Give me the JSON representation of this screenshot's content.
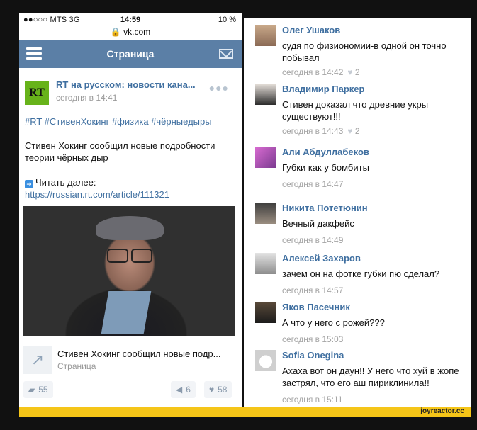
{
  "status_bar": {
    "carrier": "●●○○○ MTS  3G",
    "time": "14:59",
    "battery": "10 %"
  },
  "url": "vk.com",
  "navbar": {
    "title": "Страница"
  },
  "post": {
    "name": "RT на русском: новости кана...",
    "time": "сегодня в 14:41",
    "logo_text": "RT",
    "tags": "#RT #СтивенХокинг #физика #чёрныедыры",
    "text": "Стивен Хокинг сообщил новые подробности теории чёрных дыр",
    "read_more": "Читать далее:",
    "link": "https://russian.rt.com/article/111321",
    "share_title": "Стивен Хокинг сообщил новые подр...",
    "share_sub": "Страница",
    "comments_count": "55",
    "reposts_count": "6",
    "likes_count": "58"
  },
  "comments": [
    {
      "name": "Олег Ушаков",
      "text": "судя по физиономии-в одной он точно побывал",
      "time": "сегодня в 14:42",
      "likes": "2"
    },
    {
      "name": "Владимир Паркер",
      "text": "Стивен доказал что древние укры существуют!!!",
      "time": "сегодня в 14:43",
      "likes": "2"
    },
    {
      "name": "Али Абдуллабеков",
      "text": "Губки как у бомбиты",
      "time": "сегодня в 14:47",
      "likes": ""
    },
    {
      "name": "Никита Потетюнин",
      "text": "Вечный дакфейс",
      "time": "сегодня в 14:49",
      "likes": ""
    },
    {
      "name": "Алексей Захаров",
      "text": "зачем он на фотке губки пю сделал?",
      "time": "сегодня в 14:57",
      "likes": ""
    },
    {
      "name": "Яков Пасечник",
      "text": "А что у него с рожей???",
      "time": "сегодня в 15:03",
      "likes": ""
    },
    {
      "name": "Sofia Onegina",
      "text": "Ахаха вот он даун!! У него что хуй в жопе застрял, что его аш пириклинила!!",
      "time": "сегодня в 15:11",
      "likes": ""
    }
  ],
  "watermark": "joyreactor.cc",
  "colors": {
    "vk_blue": "#5b7fa6",
    "link": "#3f6fa0",
    "rt_green": "#67b31a",
    "watermark": "#f5c518"
  }
}
